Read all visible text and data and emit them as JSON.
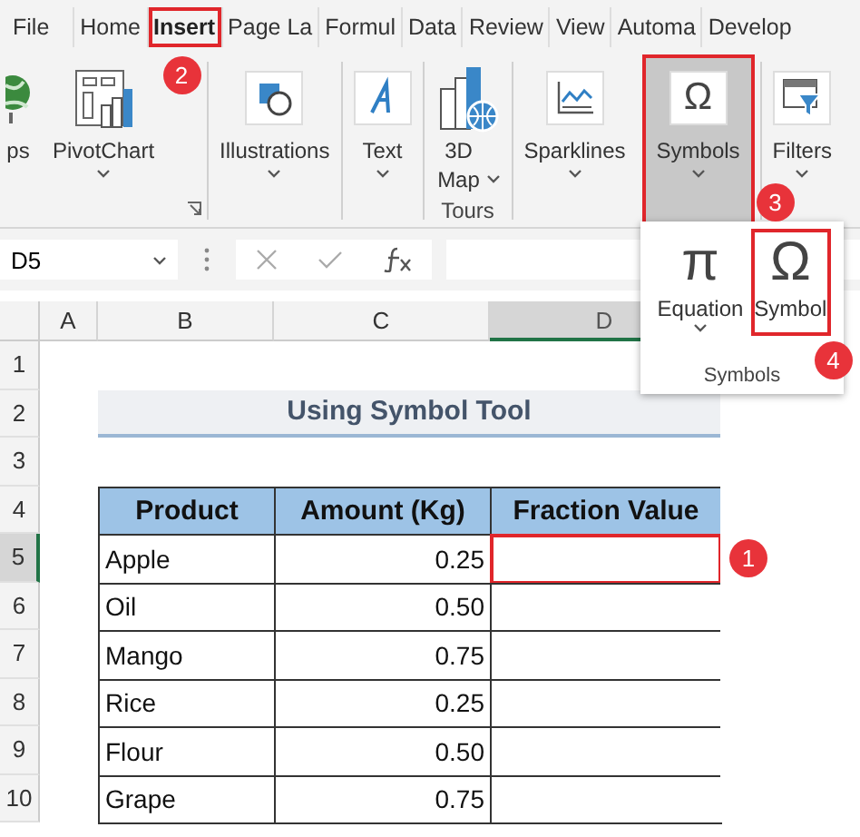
{
  "tabs": [
    {
      "label": "File",
      "selected": false
    },
    {
      "label": "Home",
      "selected": false
    },
    {
      "label": "Insert",
      "selected": true,
      "callout": "2"
    },
    {
      "label": "Page La",
      "selected": false
    },
    {
      "label": "Formul",
      "selected": false
    },
    {
      "label": "Data",
      "selected": false
    },
    {
      "label": "Review",
      "selected": false
    },
    {
      "label": "View",
      "selected": false
    },
    {
      "label": "Automa",
      "selected": false
    },
    {
      "label": "Develop",
      "selected": false
    }
  ],
  "ribbon": {
    "groups": [
      {
        "launcher": true,
        "items": [
          {
            "kind": "globe",
            "label": "ps",
            "dropdown": false,
            "selected": false
          },
          {
            "kind": "pivotchart",
            "label": "PivotChart",
            "dropdown": true,
            "selected": false
          }
        ]
      },
      {
        "items": [
          {
            "kind": "shapes",
            "label": "Illustrations",
            "dropdown": true,
            "selected": false
          }
        ]
      },
      {
        "items": [
          {
            "kind": "textbox",
            "label": "Text",
            "dropdown": true,
            "selected": false
          }
        ]
      },
      {
        "label": "Tours",
        "items": [
          {
            "kind": "map3d",
            "label": "3D Map",
            "dropdown": true,
            "selected": false
          }
        ]
      },
      {
        "items": [
          {
            "kind": "sparkline",
            "label": "Sparklines",
            "dropdown": true,
            "selected": false
          }
        ]
      },
      {
        "items": [
          {
            "kind": "glyph",
            "glyph": "Ω",
            "label": "Symbols",
            "dropdown": true,
            "selected": true,
            "callout": "3"
          }
        ]
      },
      {
        "items": [
          {
            "kind": "filter",
            "label": "Filters",
            "dropdown": true,
            "selected": false
          }
        ]
      }
    ]
  },
  "symbols_menu": {
    "title": "Symbols",
    "items": [
      {
        "glyph": "π",
        "label": "Equation",
        "dropdown": true
      },
      {
        "glyph": "Ω",
        "label": "Symbol",
        "dropdown": false,
        "callout": "4"
      }
    ]
  },
  "formula_bar": {
    "name_box": "D5"
  },
  "sheet": {
    "columns": [
      {
        "label": "A",
        "selected": false
      },
      {
        "label": "B",
        "selected": false
      },
      {
        "label": "C",
        "selected": false
      },
      {
        "label": "D",
        "selected": true
      }
    ],
    "row_numbers": [
      {
        "label": "1",
        "selected": false
      },
      {
        "label": "2",
        "selected": false
      },
      {
        "label": "3",
        "selected": false
      },
      {
        "label": "4",
        "selected": false
      },
      {
        "label": "5",
        "selected": true
      },
      {
        "label": "6",
        "selected": false
      },
      {
        "label": "7",
        "selected": false
      },
      {
        "label": "8",
        "selected": false
      },
      {
        "label": "9",
        "selected": false
      },
      {
        "label": "10",
        "selected": false
      }
    ],
    "title": "Using Symbol Tool",
    "table": {
      "columns": [
        "Product",
        "Amount (Kg)",
        "Fraction Value"
      ],
      "rows": [
        {
          "product": "Apple",
          "amount": "0.25",
          "callout": "1"
        },
        {
          "product": "Oil",
          "amount": "0.50"
        },
        {
          "product": "Mango",
          "amount": "0.75"
        },
        {
          "product": "Rice",
          "amount": "0.25"
        },
        {
          "product": "Flour",
          "amount": "0.50"
        },
        {
          "product": "Grape",
          "amount": "0.75"
        }
      ]
    }
  }
}
